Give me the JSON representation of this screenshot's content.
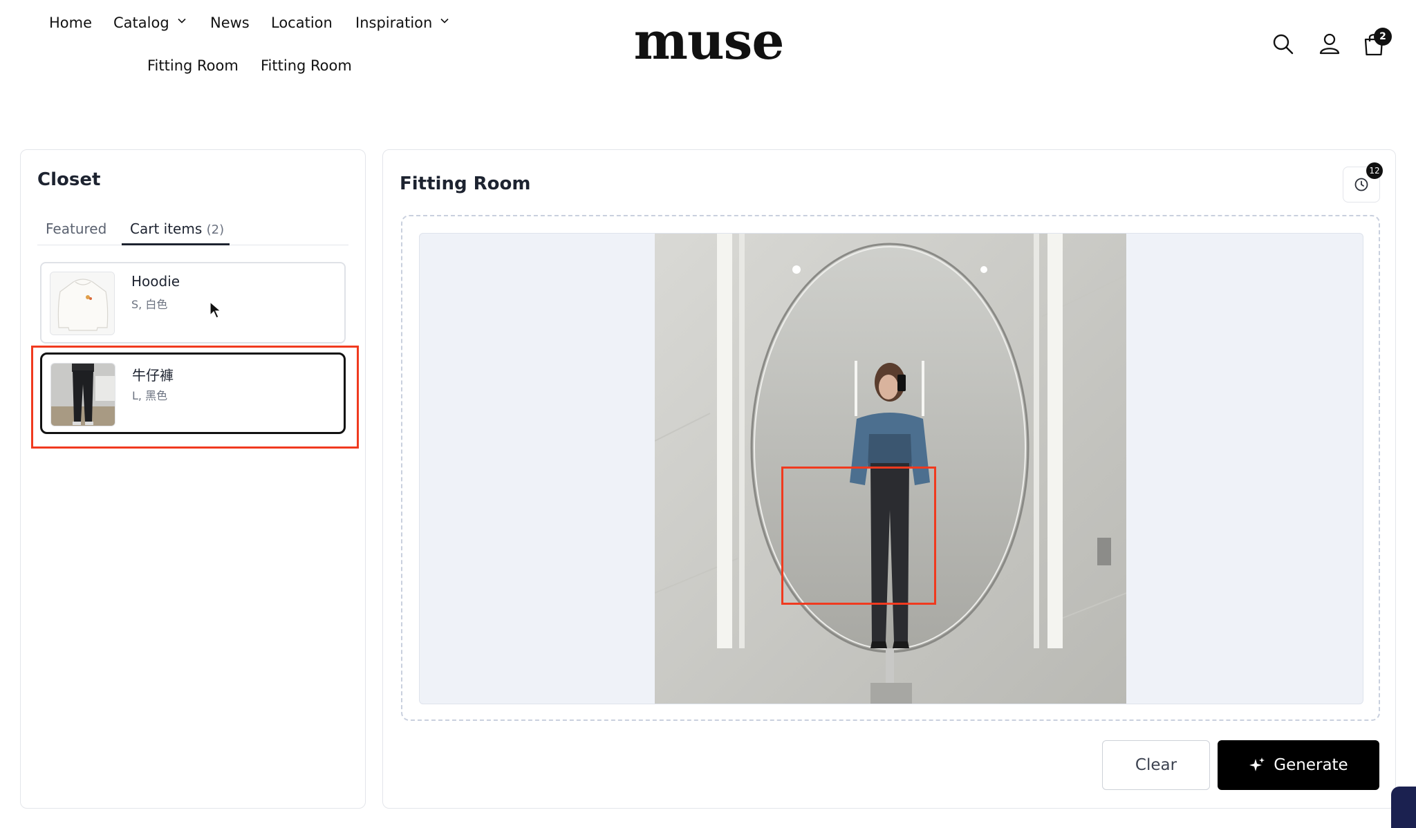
{
  "header": {
    "logo": "muse",
    "nav": [
      {
        "label": "Home"
      },
      {
        "label": "Catalog"
      },
      {
        "label": "News"
      },
      {
        "label": "Location"
      },
      {
        "label": "Inspiration"
      },
      {
        "label": "Fitting Room"
      },
      {
        "label": "Fitting Room"
      }
    ],
    "icons": [
      "search-icon",
      "account-icon",
      "cart-icon"
    ],
    "cart_count": "2"
  },
  "closet": {
    "title": "Closet",
    "tabs": {
      "featured": "Featured",
      "cart_items": "Cart items",
      "cart_items_count": "(2)"
    },
    "items": [
      {
        "name": "Hoodie",
        "variant": "S, 白色",
        "selected": false
      },
      {
        "name": "牛仔褲",
        "variant": "L, 黑色",
        "selected": true
      }
    ]
  },
  "fitting_room": {
    "title": "Fitting Room",
    "history_count": "12",
    "clear_label": "Clear",
    "generate_label": "Generate"
  },
  "colors": {
    "accent": "#000000",
    "highlight": "#f03a1f",
    "panel_border": "#e3e5ea",
    "canvas_bg": "#eff2f8"
  }
}
